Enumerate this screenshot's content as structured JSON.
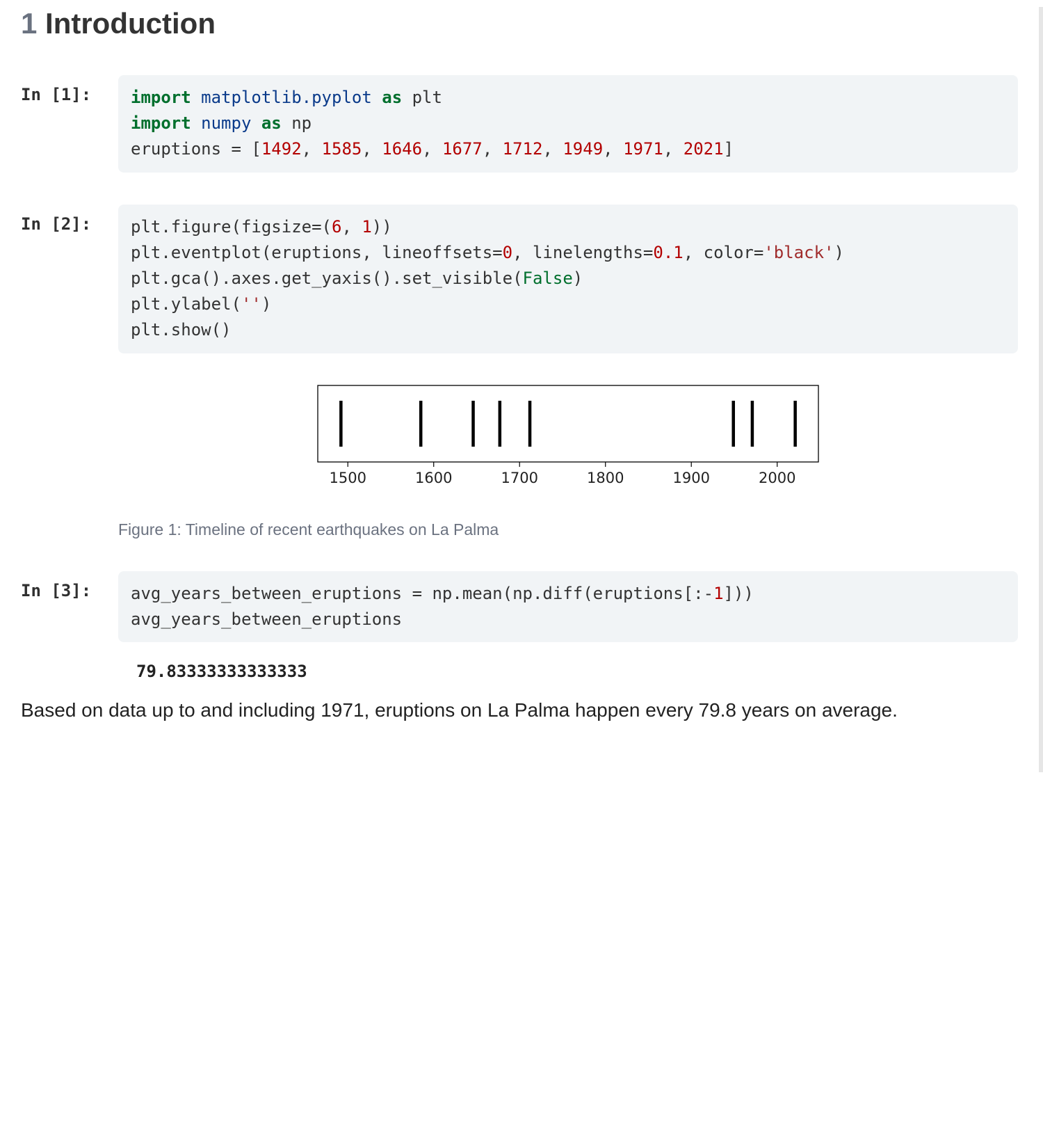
{
  "heading": {
    "number": "1",
    "title": "Introduction"
  },
  "cells": [
    {
      "prompt": "In [1]:"
    },
    {
      "prompt": "In [2]:"
    },
    {
      "prompt": "In [3]:"
    }
  ],
  "code1": {
    "kw_import_1": "import",
    "mod_1": "matplotlib.pyplot",
    "kw_as_1": "as",
    "alias_1": "plt",
    "kw_import_2": "import",
    "mod_2": "numpy",
    "kw_as_2": "as",
    "alias_2": "np",
    "var_eq": "eruptions = [",
    "nums": [
      "1492",
      "1585",
      "1646",
      "1677",
      "1712",
      "1949",
      "1971",
      "2021"
    ],
    "close": "]"
  },
  "code2": {
    "l1a": "plt.figure(figsize=(",
    "l1n1": "6",
    "l1c": ", ",
    "l1n2": "1",
    "l1b": "))",
    "l2a": "plt.eventplot(eruptions, lineoffsets=",
    "l2n1": "0",
    "l2b": ", linelengths=",
    "l2n2": "0.1",
    "l2c": ", color=",
    "l2s": "'black'",
    "l2d": ")",
    "l3": "plt.gca().axes.get_yaxis().set_visible(",
    "l3kw": "False",
    "l3b": ")",
    "l4a": "plt.ylabel(",
    "l4s": "''",
    "l4b": ")",
    "l5": "plt.show()"
  },
  "code3": {
    "l1": "avg_years_between_eruptions = np.mean(np.diff(eruptions[:-",
    "l1n": "1",
    "l1b": "]))",
    "l2": "avg_years_between_eruptions"
  },
  "output3": "79.83333333333333",
  "figure_caption": "Figure 1: Timeline of recent earthquakes on La Palma",
  "narrative": "Based on data up to and including 1971, eruptions on La Palma happen every 79.8 years on average.",
  "chart_data": {
    "type": "eventplot",
    "title": "",
    "xlabel": "",
    "ylabel": "",
    "x": [
      1492,
      1585,
      1646,
      1677,
      1712,
      1949,
      1971,
      2021
    ],
    "x_ticks": [
      1500,
      1600,
      1700,
      1800,
      1900,
      2000
    ],
    "xlim": [
      1465,
      2048
    ],
    "ylim": [
      -0.06,
      0.06
    ],
    "grid": false
  }
}
